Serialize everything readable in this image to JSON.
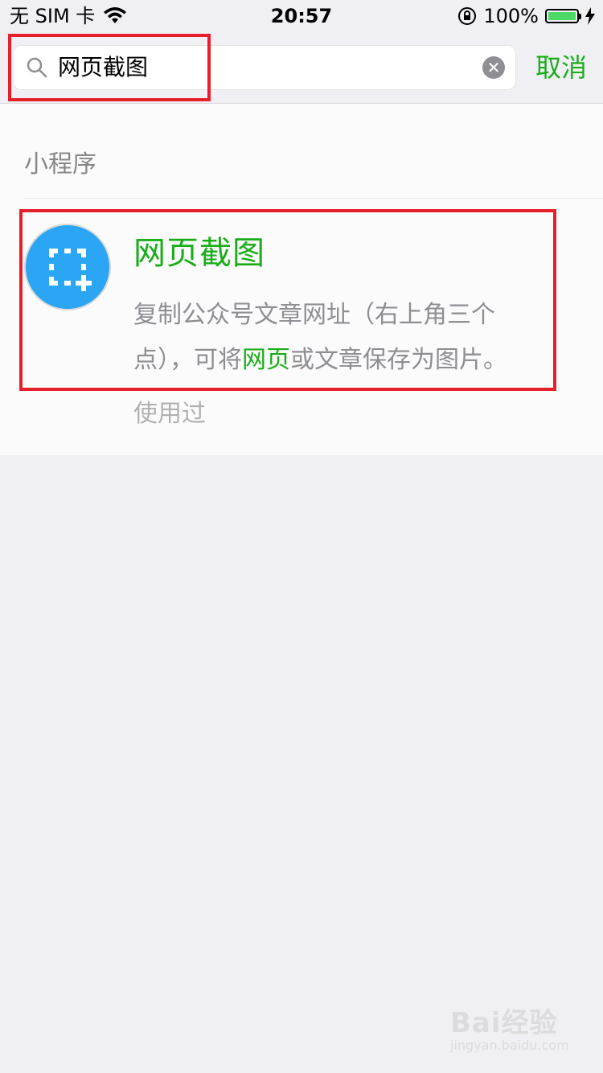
{
  "status_bar": {
    "carrier": "无 SIM 卡",
    "time": "20:57",
    "battery": "100%",
    "battery_level": 1.0
  },
  "search": {
    "query": "网页截图",
    "cancel_label": "取消"
  },
  "results": {
    "section_title": "小程序",
    "item": {
      "name": "网页截图",
      "desc_part1": "复制公众号文章网址（右上角三个点），可将",
      "desc_highlight": "网页",
      "desc_part2": "或文章保存为图片。",
      "used_label": "使用过"
    }
  },
  "watermark": {
    "brand": "Bai经验",
    "sub": "jingyan.baidu.com"
  },
  "colors": {
    "accent_green": "#1aad19",
    "annotation_red": "#e5202a",
    "icon_blue": "#2aa6f5"
  }
}
